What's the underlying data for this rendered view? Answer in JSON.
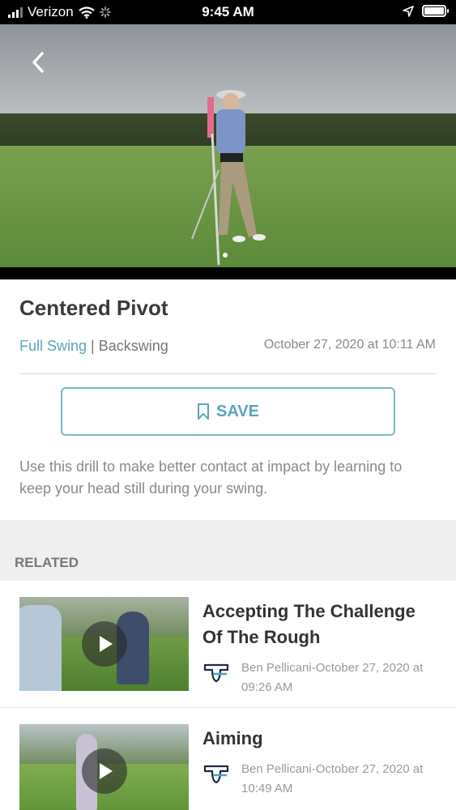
{
  "status_bar": {
    "carrier": "Verizon",
    "time": "9:45 AM"
  },
  "video": {
    "back_icon": "chevron-left-icon"
  },
  "drill": {
    "title": "Centered Pivot",
    "category_primary": "Full Swing",
    "category_secondary": "| Backswing",
    "date": "October 27, 2020 at 10:11 AM",
    "save_label": "SAVE",
    "description": "Use this drill to make better contact at impact by learning to keep your head still during your swing."
  },
  "related": {
    "header": "RELATED",
    "items": [
      {
        "title": "Accepting The Challenge Of The Rough",
        "byline": "Ben Pellicani-October 27, 2020 at 09:26 AM"
      },
      {
        "title": "Aiming",
        "byline": "Ben Pellicani-October 27, 2020 at 10:49 AM"
      }
    ]
  },
  "colors": {
    "accent": "#5aa6bd",
    "status_bar_bg": "#000000",
    "related_header_bg": "#efefef"
  }
}
